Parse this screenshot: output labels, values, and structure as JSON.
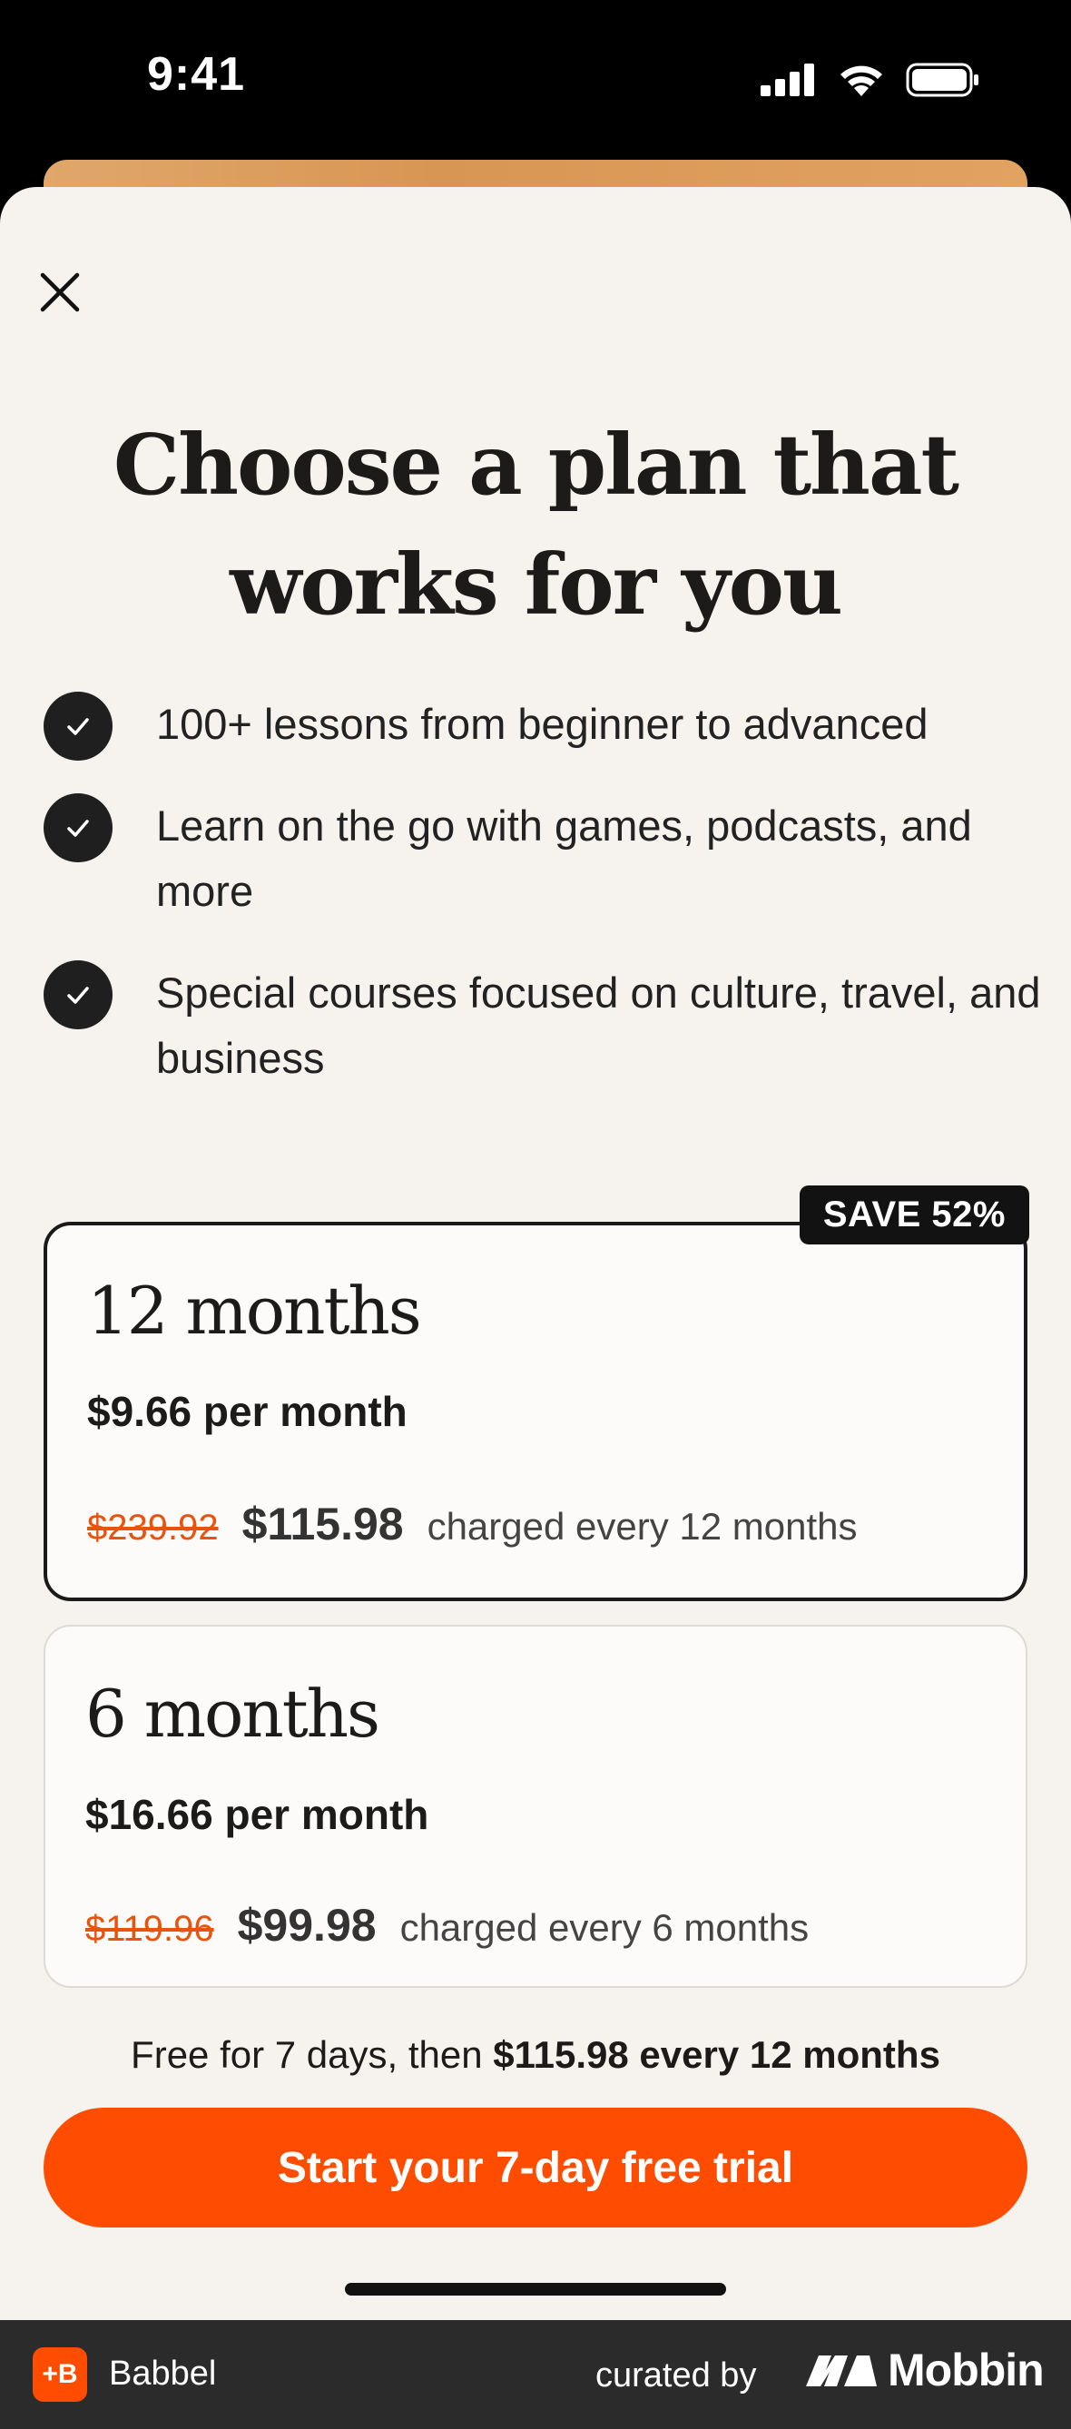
{
  "status": {
    "time": "9:41"
  },
  "sheet": {
    "close_icon": "close-icon",
    "title": "Choose a plan that works for you"
  },
  "features": [
    {
      "text": "100+ lessons from beginner to advanced"
    },
    {
      "text": "Learn on the go with games, podcasts, and more"
    },
    {
      "text": "Special courses focused on culture, travel, and business"
    }
  ],
  "plans": [
    {
      "badge": "SAVE 52%",
      "duration": "12 months",
      "monthly": "$9.66 per month",
      "old_price": "$239.92",
      "new_price": "$115.98",
      "charge_note": "charged every 12 months",
      "selected": true
    },
    {
      "duration": "6 months",
      "monthly": "$16.66 per month",
      "old_price": "$119.96",
      "new_price": "$99.98",
      "charge_note": "charged every 6 months",
      "selected": false
    }
  ],
  "trial": {
    "prefix": "Free for 7 days, then ",
    "bold": "$115.98 every 12 months"
  },
  "cta": {
    "label": "Start your 7-day free trial"
  },
  "footer": {
    "brand_logo_text": "+B",
    "brand_name": "Babbel",
    "curated_by": "curated by",
    "mobbin": "Mobbin"
  },
  "colors": {
    "accent": "#fe4c00",
    "sheet_bg": "#f6f2ee",
    "strike_price": "#e8540e"
  }
}
